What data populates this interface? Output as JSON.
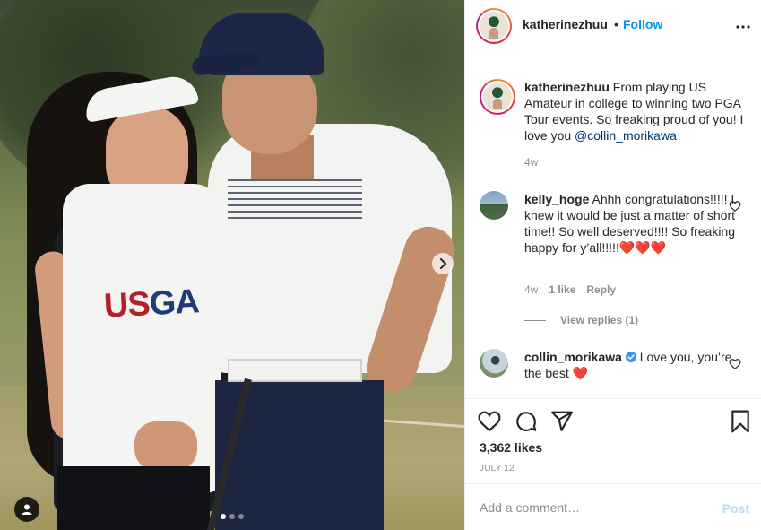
{
  "post": {
    "author": "katherinezhuu",
    "bullet": "•",
    "follow_label": "Follow",
    "more_icon": "more-horizontal-icon",
    "carousel": {
      "slides": 3,
      "active_index": 0
    }
  },
  "caption": {
    "username": "katherinezhuu",
    "text": "From playing US Amateur in college to winning two PGA Tour events. So freaking proud of you! I love you",
    "mention": "@collin_morikawa",
    "age": "4w"
  },
  "photo": {
    "logo_us": "US",
    "logo_ga": "GA"
  },
  "comments": [
    {
      "username": "kelly_hoge",
      "text": "Ahhh congratulations!!!!! I knew it would be just a matter of short time!! So well deserved!!!! So freaking happy for y’all!!!!!❤️❤️❤️",
      "age": "4w",
      "likes": "1 like",
      "reply": "Reply",
      "view_replies": "View replies (1)"
    },
    {
      "username": "collin_morikawa",
      "verified": true,
      "text": "Love you, you’re the best ❤️"
    }
  ],
  "actions": {
    "likes": "3,362 likes",
    "date": "JULY 12"
  },
  "add_comment": {
    "placeholder": "Add a comment…",
    "post_label": "Post"
  },
  "colors": {
    "link": "#0095f6",
    "post_disabled": "#b2dffc",
    "muted": "#8e8e8e",
    "text": "#262626"
  }
}
